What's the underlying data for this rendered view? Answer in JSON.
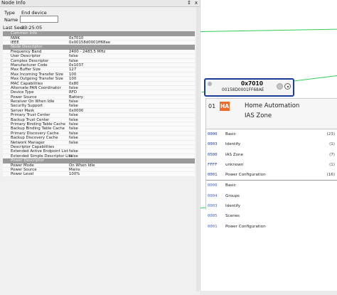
{
  "panel": {
    "title": "Node Info",
    "close_glyph": "x",
    "tb_glyph": "↕",
    "type_label": "Type",
    "type_value": "End device",
    "name_label": "Name",
    "name_value": "",
    "lastseen_label": "Last Seen",
    "lastseen_value": "13:25:05"
  },
  "sections": [
    {
      "title": "Common Info",
      "rows": [
        {
          "key": "NWK",
          "value": "0x7010"
        },
        {
          "key": "IEEE",
          "value": "0x00158d0001ff68ae"
        }
      ]
    },
    {
      "title": "Node Descriptor",
      "rows": [
        {
          "key": "Frequency Band",
          "value": "2400 - 2483.5 MHz"
        },
        {
          "key": "User Descriptor",
          "value": "false"
        },
        {
          "key": "Complex Descriptor",
          "value": "false"
        },
        {
          "key": "Manufacturer Code",
          "value": "0x1037"
        },
        {
          "key": "Max Buffer Size",
          "value": "127"
        },
        {
          "key": "Max Incoming Transfer Size",
          "value": "100"
        },
        {
          "key": "Max Outgoing Transfer Size",
          "value": "100"
        },
        {
          "key": "MAC Capabilities",
          "value": "0x80"
        },
        {
          "key": "Alternate PAN Coordinator",
          "value": "false"
        },
        {
          "key": "Device Type",
          "value": "RFD"
        },
        {
          "key": "Power Source",
          "value": "Battery"
        },
        {
          "key": "Receiver On When Idle",
          "value": "false"
        },
        {
          "key": "Security Support",
          "value": "false"
        },
        {
          "key": "Server Mask",
          "value": "0x0000"
        },
        {
          "key": "Primary Trust Center",
          "value": "false"
        },
        {
          "key": "Backup Trust Center",
          "value": "false"
        },
        {
          "key": "Primary Binding Table Cache",
          "value": "false"
        },
        {
          "key": "Backup Binding Table Cache",
          "value": "false"
        },
        {
          "key": "Primary Discovery Cache",
          "value": "false"
        },
        {
          "key": "Backup Discovery Cache",
          "value": "false"
        },
        {
          "key": "Network Manager",
          "value": "false"
        },
        {
          "key": "Descriptor Capabilities",
          "value": ""
        },
        {
          "key": "Extended Active Endpoint List",
          "value": "false"
        },
        {
          "key": "Extended Simple Descriptor List",
          "value": "false"
        }
      ]
    },
    {
      "title": "Power Descriptor",
      "rows": [
        {
          "key": "Power Mode",
          "value": "On When Idle"
        },
        {
          "key": "Power Source",
          "value": "Mains"
        },
        {
          "key": "Power Level",
          "value": "100%"
        }
      ]
    }
  ],
  "node": {
    "nwk": "0x7010",
    "ieee": "00158D0001FF68AE"
  },
  "endpoint": {
    "number": "01",
    "profile_badge": "HA",
    "profile_name": "Home Automation",
    "device_name": "IAS Zone",
    "server_clusters": [
      {
        "id": "0000",
        "name": "Basic",
        "count": "(23)"
      },
      {
        "id": "0003",
        "name": "Identify",
        "count": "(1)"
      },
      {
        "id": "0500",
        "name": "IAS Zone",
        "count": "(7)"
      },
      {
        "id": "FFFF",
        "name": "unknown",
        "count": "(1)"
      },
      {
        "id": "0001",
        "name": "Power Configuration",
        "count": "(16)"
      }
    ],
    "client_clusters": [
      {
        "id": "0000",
        "name": "Basic",
        "count": ""
      },
      {
        "id": "0004",
        "name": "Groups",
        "count": ""
      },
      {
        "id": "0003",
        "name": "Identify",
        "count": ""
      },
      {
        "id": "0005",
        "name": "Scenes",
        "count": ""
      },
      {
        "id": "0001",
        "name": "Power Configuration",
        "count": ""
      }
    ]
  },
  "colors": {
    "link": "#33cc55",
    "selection": "#1a3d9a",
    "profile_badge": "#ee6a2a",
    "section_header": "#9a9a9a"
  }
}
